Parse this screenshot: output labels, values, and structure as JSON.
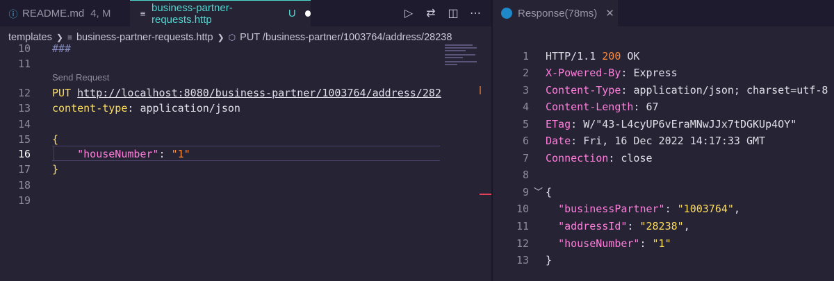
{
  "tabs": [
    {
      "icon": "info-icon",
      "label": "README.md",
      "badge": "4, M"
    },
    {
      "icon": "lines-icon",
      "label": "business-partner-requests.http",
      "badge": "U"
    }
  ],
  "breadcrumb": {
    "folder": "templates",
    "file": "business-partner-requests.http",
    "request": "PUT /business-partner/1003764/address/28238"
  },
  "editor": {
    "lines": [
      {
        "num": "10",
        "text": "###"
      },
      {
        "num": "11",
        "text": ""
      },
      {
        "num": "12",
        "method": "PUT",
        "url": "http://localhost:8080/business-partner/1003764/address/282"
      },
      {
        "num": "13",
        "header_key": "content-type",
        "header_value": "application/json"
      },
      {
        "num": "14",
        "text": ""
      },
      {
        "num": "15",
        "text": "{"
      },
      {
        "num": "16",
        "json_key": "\"houseNumber\"",
        "json_value": "\"1\""
      },
      {
        "num": "17",
        "text": "}"
      },
      {
        "num": "18",
        "text": ""
      },
      {
        "num": "19",
        "text": ""
      }
    ],
    "codelens": "Send Request"
  },
  "response": {
    "tab_label": "Response(78ms)",
    "lines": [
      {
        "num": "1",
        "parts": [
          "HTTP/1.1 ",
          "200",
          " OK"
        ]
      },
      {
        "num": "2",
        "key": "X-Powered-By",
        "value": "Express"
      },
      {
        "num": "3",
        "key": "Content-Type",
        "value": "application/json; charset=utf-8"
      },
      {
        "num": "4",
        "key": "Content-Length",
        "value": "67"
      },
      {
        "num": "5",
        "key": "ETag",
        "value": "W/\"43-L4cyUP6vEraMNwJJx7tDGKUp4OY\""
      },
      {
        "num": "6",
        "key": "Date",
        "value": "Fri, 16 Dec 2022 14:17:33 GMT"
      },
      {
        "num": "7",
        "key": "Connection",
        "value": "close"
      },
      {
        "num": "8",
        "text": ""
      },
      {
        "num": "9",
        "text": "{"
      },
      {
        "num": "10",
        "jkey": "\"businessPartner\"",
        "jval": "\"1003764\"",
        "trail": ","
      },
      {
        "num": "11",
        "jkey": "\"addressId\"",
        "jval": "\"28238\"",
        "trail": ","
      },
      {
        "num": "12",
        "jkey": "\"houseNumber\"",
        "jval": "\"1\"",
        "trail": ""
      },
      {
        "num": "13",
        "text": "}"
      }
    ]
  },
  "colors": {
    "background": "#262335",
    "accent_teal": "#4fd8d0",
    "keyword_yellow": "#fede5d",
    "string_orange": "#ff8b39",
    "property_pink": "#ff7edb"
  }
}
